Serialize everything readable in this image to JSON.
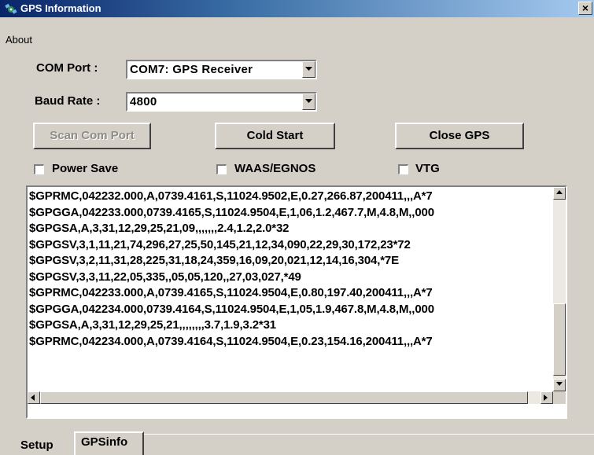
{
  "window": {
    "title": "GPS Information",
    "close_glyph": "×",
    "icon": "satellite-icon"
  },
  "menu": {
    "about": "About"
  },
  "com_port": {
    "label": "COM Port :",
    "value": "COM7:  GPS Receiver"
  },
  "baud_rate": {
    "label": "Baud Rate :",
    "value": "4800"
  },
  "buttons": {
    "scan": "Scan Com Port",
    "cold_start": "Cold Start",
    "close_gps": "Close GPS"
  },
  "checkboxes": {
    "power_save": "Power Save",
    "waas": "WAAS/EGNOS",
    "vtg": "VTG"
  },
  "log_lines": [
    "$GPRMC,042232.000,A,0739.4161,S,11024.9502,E,0.27,266.87,200411,,,A*7",
    "$GPGGA,042233.000,0739.4165,S,11024.9504,E,1,06,1.2,467.7,M,4.8,M,,000",
    "$GPGSA,A,3,31,12,29,25,21,09,,,,,,,2.4,1.2,2.0*32",
    "$GPGSV,3,1,11,21,74,296,27,25,50,145,21,12,34,090,22,29,30,172,23*72",
    "$GPGSV,3,2,11,31,28,225,31,18,24,359,16,09,20,021,12,14,16,304,*7E",
    "$GPGSV,3,3,11,22,05,335,,05,05,120,,27,03,027,*49",
    "$GPRMC,042233.000,A,0739.4165,S,11024.9504,E,0.80,197.40,200411,,,A*7",
    "$GPGGA,042234.000,0739.4164,S,11024.9504,E,1,05,1.9,467.8,M,4.8,M,,000",
    "$GPGSA,A,3,31,12,29,25,21,,,,,,,,3.7,1.9,3.2*31",
    "$GPRMC,042234.000,A,0739.4164,S,11024.9504,E,0.23,154.16,200411,,,A*7"
  ],
  "tabs": {
    "setup": "Setup",
    "gpsinfo": "GPSinfo"
  }
}
